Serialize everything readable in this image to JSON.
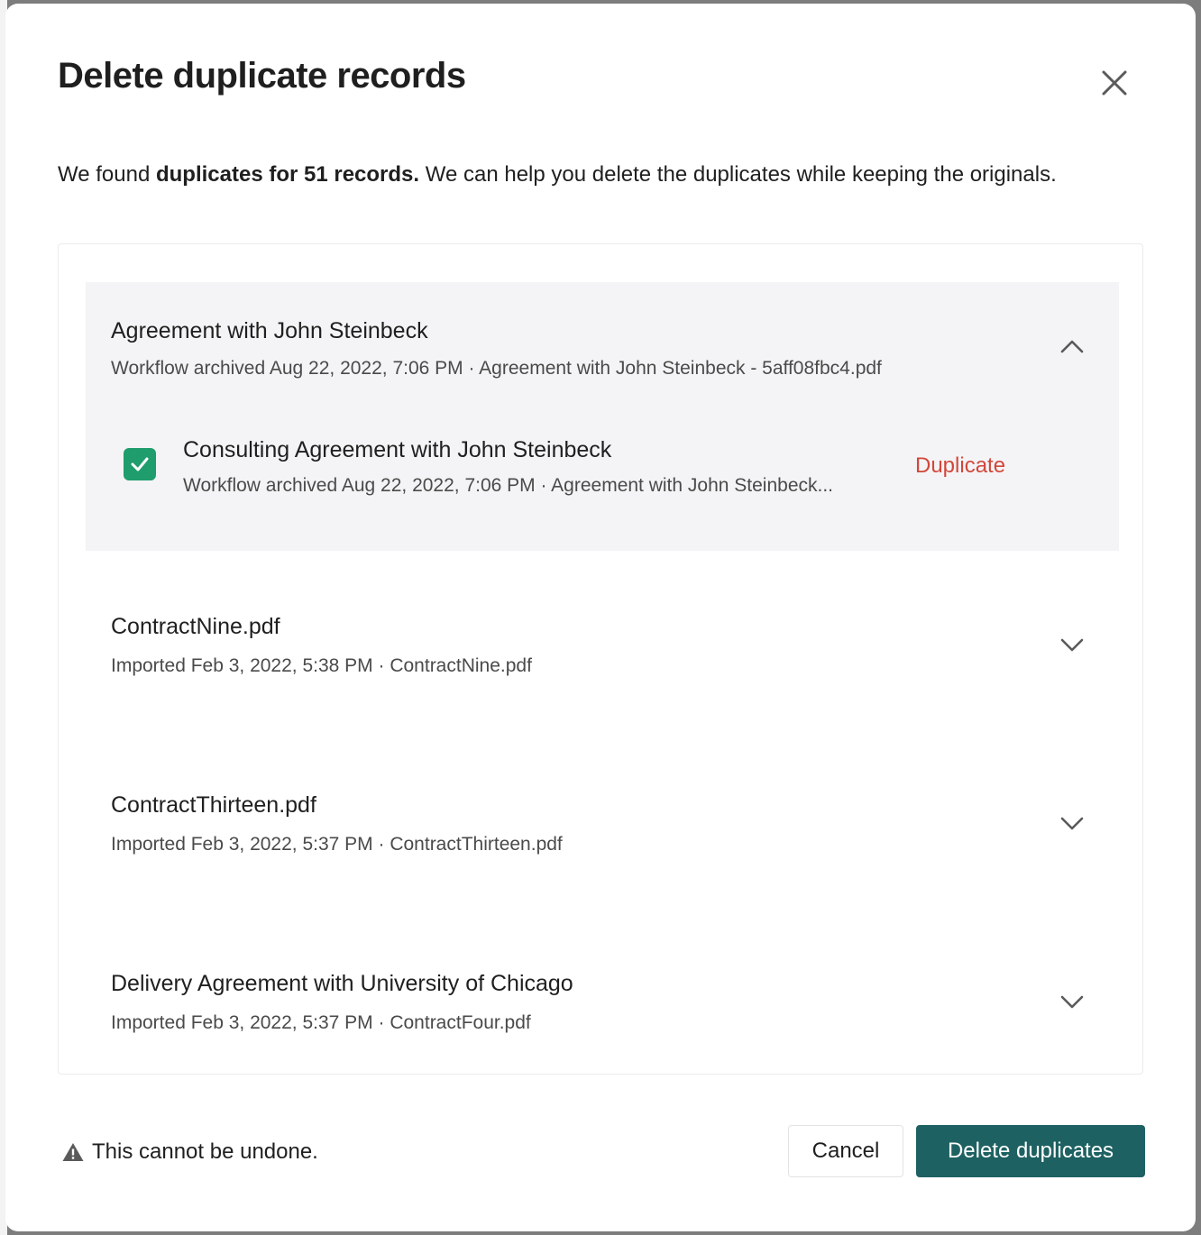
{
  "dialog": {
    "title": "Delete duplicate records",
    "intro_prefix": "We found ",
    "intro_bold": "duplicates for 51 records.",
    "intro_suffix": " We can help you delete the duplicates while keeping the originals."
  },
  "records": [
    {
      "title": "Agreement with John Steinbeck",
      "meta": "Workflow archived Aug 22, 2022, 7:06 PM · Agreement with John Steinbeck - 5aff08fbc4.pdf",
      "expanded": true,
      "duplicate": {
        "title": "Consulting Agreement with John Steinbeck",
        "meta": "Workflow archived Aug 22, 2022, 7:06 PM · Agreement with John Steinbeck...",
        "badge": "Duplicate",
        "checked": true
      }
    },
    {
      "title": "ContractNine.pdf",
      "meta": "Imported Feb 3, 2022, 5:38 PM · ContractNine.pdf",
      "expanded": false
    },
    {
      "title": "ContractThirteen.pdf",
      "meta": "Imported Feb 3, 2022, 5:37 PM · ContractThirteen.pdf",
      "expanded": false
    },
    {
      "title": "Delivery Agreement with University of Chicago",
      "meta": "Imported Feb 3, 2022, 5:37 PM · ContractFour.pdf",
      "expanded": false
    }
  ],
  "footer": {
    "warning": "This cannot be undone.",
    "cancel_label": "Cancel",
    "delete_label": "Delete duplicates"
  },
  "colors": {
    "primary": "#1e6162",
    "checkbox": "#1f9d6d",
    "duplicate_badge": "#d2473a",
    "expanded_bg": "#f4f4f6"
  },
  "icons": {
    "close": "close-icon",
    "collapse": "chevron-up-icon",
    "expand": "chevron-down-icon",
    "check": "check-icon",
    "warning": "warning-triangle-icon"
  }
}
